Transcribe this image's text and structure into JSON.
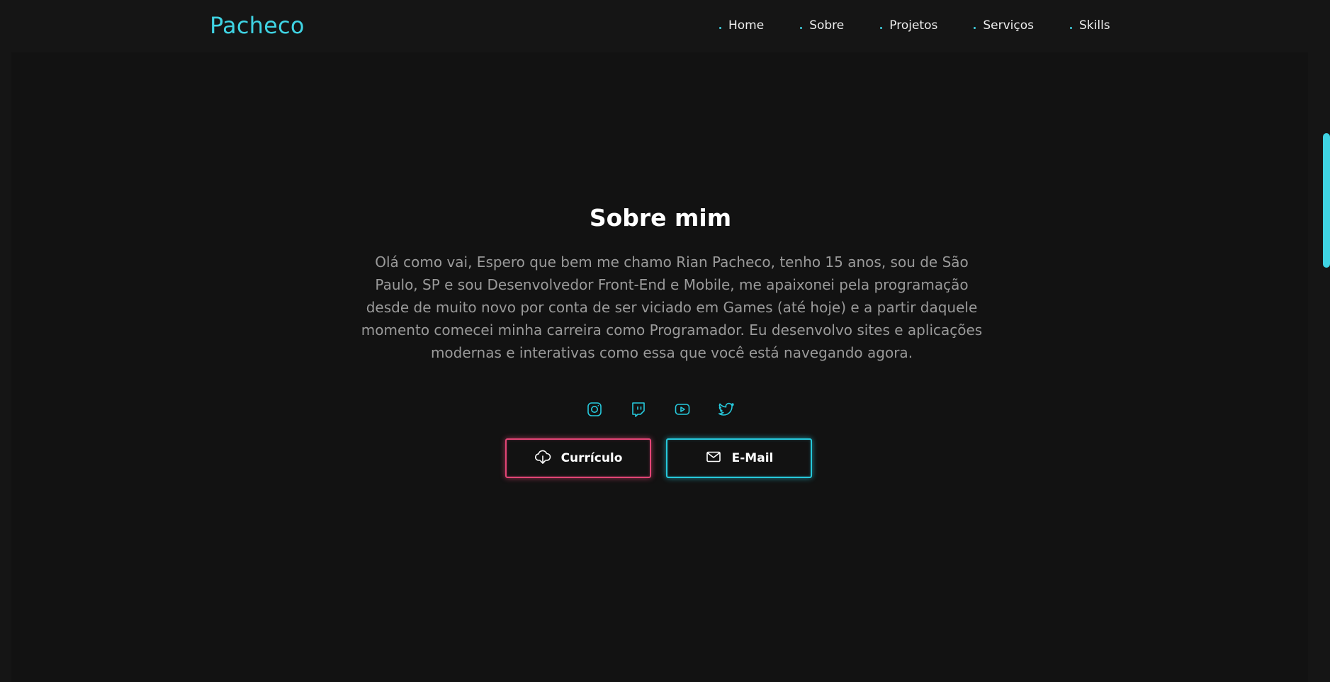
{
  "header": {
    "logo": "Pacheco",
    "nav": [
      {
        "label": "Home"
      },
      {
        "label": "Sobre"
      },
      {
        "label": "Projetos"
      },
      {
        "label": "Serviços"
      },
      {
        "label": "Skills"
      }
    ]
  },
  "about": {
    "title": "Sobre mim",
    "description": "Olá como vai, Espero que bem me chamo Rian Pacheco, tenho 15 anos, sou de São Paulo, SP e sou Desenvolvedor Front-End e Mobile, me apaixonei pela programação desde de muito novo por conta de ser viciado em Games (até hoje) e a partir daquele momento comecei minha carreira como Programador. Eu desenvolvo sites e aplicações modernas e interativas como essa que você está navegando agora.",
    "socials": [
      {
        "icon": "instagram-icon"
      },
      {
        "icon": "twitch-icon"
      },
      {
        "icon": "youtube-icon"
      },
      {
        "icon": "twitter-icon"
      }
    ],
    "buttons": {
      "resume_label": "Currículo",
      "email_label": "E-Mail"
    }
  },
  "colors": {
    "accent": "#3fd3e3",
    "pink": "#e34576",
    "background": "#121212",
    "text_muted": "#9a9a9a"
  }
}
